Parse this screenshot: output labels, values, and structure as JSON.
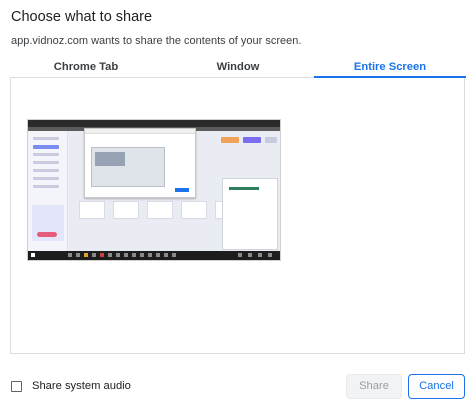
{
  "dialog": {
    "title": "Choose what to share",
    "subtitle": "app.vidnoz.com wants to share the contents of your screen."
  },
  "tabs": [
    {
      "label": "Chrome Tab",
      "active": false
    },
    {
      "label": "Window",
      "active": false
    },
    {
      "label": "Entire Screen",
      "active": true
    }
  ],
  "screens": [
    {
      "name": "screen-1",
      "selected": false
    }
  ],
  "footer": {
    "audio_checkbox_checked": false,
    "audio_label": "Share system audio",
    "share_label": "Share",
    "share_enabled": false,
    "cancel_label": "Cancel"
  },
  "colors": {
    "accent": "#1a73e8",
    "disabled_text": "#9aa0a6",
    "border": "#dadce0"
  },
  "icons": {
    "checkbox": "checkbox-unchecked-icon"
  }
}
